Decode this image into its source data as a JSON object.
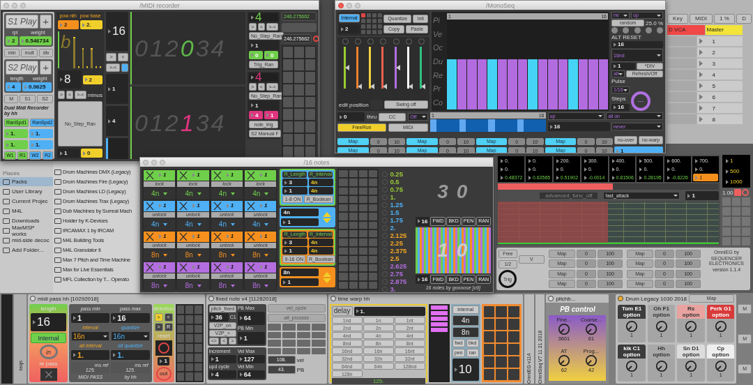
{
  "recorder": {
    "title": "/MIDI recorder",
    "s1": {
      "play": "S1 Play",
      "plus": "+",
      "labels": [
        "rpt",
        "weight"
      ],
      "values": [
        "2",
        "0.546734"
      ]
    },
    "ops": [
      "min",
      "mult",
      "div"
    ],
    "s2": {
      "play": "S2 Play",
      "plus": "+",
      "labels": [
        "length",
        "weight"
      ],
      "values": [
        "4",
        "0.0625"
      ]
    },
    "modes": [
      "M",
      "S1",
      "S2"
    ],
    "credit": "Dual Midi Recorder by hh",
    "ran": [
      "RanSpd1",
      "RanSpd2"
    ],
    "ran_values": [
      "1.",
      "1.",
      "1.",
      "1."
    ],
    "wr": [
      "W1",
      "R1",
      "W2",
      "R2"
    ],
    "pow_labels": [
      "pow nth",
      "pow base"
    ],
    "pow_values": [
      "2",
      "2."
    ],
    "bars_glyph": "b",
    "steps": "8",
    "steps_alt": "2",
    "dir_buttons": [
      ">",
      "<",
      ">-<"
    ],
    "minus": "minus",
    "mode": "No_Step_Ran",
    "bottom_values": [
      "1",
      "0"
    ],
    "length": "16",
    "len_buttons": [
      ">",
      "<",
      ">-<"
    ],
    "len_values": [
      "1",
      "4"
    ],
    "displays": [
      {
        "color": "#5fb84a",
        "digits": [
          {
            "text": "0",
            "current": false
          },
          {
            "text": "1",
            "current": false
          },
          {
            "text": "2",
            "current": false
          },
          {
            "text": "0",
            "current": true
          },
          {
            "text": "3",
            "current": false
          },
          {
            "text": "4",
            "current": false
          }
        ]
      },
      {
        "color": "#e0357f",
        "digits": [
          {
            "text": "0",
            "current": false
          },
          {
            "text": "1",
            "current": false
          },
          {
            "text": "2",
            "current": false
          },
          {
            "text": "1",
            "current": true
          },
          {
            "text": "3",
            "current": false
          },
          {
            "text": "4",
            "current": false
          }
        ]
      }
    ],
    "lanes": [
      {
        "value": "4",
        "buttons": [
          ">",
          "<",
          ">-<"
        ],
        "mode": "No_Step_Ran",
        "step": "1",
        "pair": [
          "0",
          "0"
        ],
        "trigger": "Trig_Ran",
        "color": "#6fcf4a"
      },
      {
        "value": "4",
        "buttons": [
          ">",
          "<",
          ">-<"
        ],
        "mode": "No_Step_Ran",
        "step": "1",
        "pair": [
          "4",
          "1"
        ],
        "trigger": "note_trig",
        "extra": "S2 Manual F",
        "color": "#e0357f"
      }
    ],
    "readouts": [
      "246.275662",
      "246.275662"
    ]
  },
  "monoseq": {
    "title": "/MonoSeq",
    "clock": "Internal",
    "channel": "2",
    "edit_buttons": [
      "Quantize",
      "Init",
      "Copy",
      "Paste"
    ],
    "sliders": [
      {
        "color": "#9acd32",
        "level": 0.5
      },
      {
        "color": "#f08030",
        "level": 0.05
      },
      {
        "color": "#f0d040",
        "level": 0.05
      },
      {
        "color": "#f06050",
        "level": 0.05
      },
      {
        "color": "#b070e0",
        "level": 0.5
      },
      {
        "color": "#ffffff",
        "level": 0.05
      },
      {
        "color": "#30c080",
        "level": 0.05
      }
    ],
    "edit_position": "edit position",
    "swing": "Swing off",
    "rows": [
      "Pi",
      "Ve",
      "Oc",
      "Du",
      "Re",
      "Pr",
      "Co"
    ],
    "range": {
      "start": "1",
      "end": "16",
      "level": 1
    },
    "steps": [
      {
        "accent": true
      },
      {
        "accent": false
      },
      {
        "accent": false
      },
      {
        "accent": false
      },
      {
        "accent": true
      },
      {
        "accent": false
      },
      {
        "accent": false
      },
      {
        "accent": false
      },
      {
        "accent": true
      },
      {
        "accent": false
      },
      {
        "accent": false
      },
      {
        "accent": false
      },
      {
        "accent": true
      },
      {
        "accent": false
      },
      {
        "accent": false
      },
      {
        "accent": false
      }
    ],
    "direction": [
      "ne",
      "up"
    ],
    "random": "random",
    "random_pct": "25.0 %",
    "alt_reset": "ALT RESET",
    "reset_value": "16",
    "division": "16nd",
    "div_value": "1",
    "div_op": "*DIV",
    "filter": "all",
    "refresh": "Refresh/Off",
    "pulse_label": "Pulse",
    "pulse": "1/16",
    "steps_label": "Steps",
    "steps_value": "16",
    "dial": "---",
    "footer": {
      "thru_value": "0",
      "thru": "thru",
      "cc": "CC",
      "midi_mode": "Off",
      "freerun": "FreeRun",
      "midi": "MIDI",
      "range": {
        "start": "1",
        "end": "16",
        "level": 1
      },
      "order": "up",
      "gate": "all on",
      "count": "16",
      "repeat": "never"
    },
    "maps": [
      {
        "label": "Map",
        "min": "0",
        "max": "10"
      },
      {
        "label": "Map",
        "min": "0",
        "max": "10"
      },
      {
        "label": "Map",
        "min": "0",
        "max": "10"
      },
      {
        "label": "Map",
        "min": "0",
        "max": "10"
      },
      {
        "label": "Map",
        "min": "0",
        "max": "10"
      },
      {
        "label": "Map",
        "min": "0",
        "max": "10"
      },
      {
        "label": "Map",
        "min": "0",
        "max": "10"
      },
      {
        "label": "Map",
        "min": "0",
        "max": "10"
      }
    ],
    "no_over": "no-over",
    "no_warp": "no-warp",
    "output": "1"
  },
  "live": {
    "toolbar": [
      "Key",
      "MIDI",
      "1 %",
      "D"
    ],
    "tracks": [
      {
        "name": "D VCA",
        "color": "#f04848"
      },
      {
        "name": "Master",
        "color": "#f2e43a"
      }
    ],
    "slots": [
      "1",
      "2",
      "3",
      "4",
      "5",
      "6",
      "7",
      "8"
    ]
  },
  "browser": {
    "places_title": "Places",
    "places": [
      {
        "label": "Packs",
        "selected": true
      },
      {
        "label": "User Library",
        "selected": false
      },
      {
        "label": "Current Projec",
        "selected": false
      },
      {
        "label": "M4L",
        "selected": false
      },
      {
        "label": "Downloads",
        "selected": false
      },
      {
        "label": "MaxMSP works",
        "selected": false
      },
      {
        "label": "mid-side decoc",
        "selected": false
      },
      {
        "label": "Add Folder...",
        "selected": false
      }
    ],
    "items": [
      "Drum Machines DMX (Legacy)",
      "Drum Machines Fire (Legacy)",
      "Drum Machines LD (Legacy)",
      "Drum Machines Trax (Legacy)",
      "Dub Machines by Surreal Mach",
      "Holder by K-Devices",
      "IRCAMAX 1 by IRCAM",
      "M4L Building Tools",
      "M4L Granulator II",
      "Max 7 Pitch and Time Machine",
      "Max for Live Essentials",
      "MFL Collection by T... Operato"
    ]
  },
  "notes": {
    "title": "/16 notes",
    "groups": [
      {
        "color": "#6fcf4a",
        "cells": [
          {
            "value": "1",
            "lock": "lock",
            "rate": "4n"
          },
          {
            "value": "1",
            "lock": "lock",
            "rate": "4n"
          },
          {
            "value": "1",
            "lock": "lock",
            "rate": "4n"
          },
          {
            "value": "1",
            "lock": "lock",
            "rate": "4n"
          }
        ]
      },
      {
        "color": "#4fb0f5",
        "cells": [
          {
            "value": "1",
            "lock": "unlock",
            "rate": "4n"
          },
          {
            "value": "1",
            "lock": "unlock",
            "rate": "4n"
          },
          {
            "value": "1",
            "lock": "unlock",
            "rate": "4n"
          },
          {
            "value": "1",
            "lock": "unlock",
            "rate": "4n"
          }
        ]
      },
      {
        "color": "#f5901e",
        "cells": [
          {
            "value": "1",
            "lock": "unlock",
            "rate": "8n"
          },
          {
            "value": "1",
            "lock": "unlock",
            "rate": "8n"
          },
          {
            "value": "1",
            "lock": "unlock",
            "rate": "8n"
          },
          {
            "value": "1",
            "lock": "unlock",
            "rate": "8n"
          }
        ]
      },
      {
        "color": "#b46ee0",
        "cells": [
          {
            "value": "1",
            "lock": "unlock",
            "rate": "8n"
          },
          {
            "value": "1",
            "lock": "unlock",
            "rate": "8n"
          },
          {
            "value": "1",
            "lock": "unlock",
            "rate": "8n"
          },
          {
            "value": "1",
            "lock": "unlock",
            "rate": "8n"
          }
        ]
      }
    ],
    "randomizers": [
      {
        "color": "#4fb0f5",
        "labels": [
          "R_Length",
          "R_Interval"
        ],
        "rows": [
          [
            "3",
            "4n"
          ],
          [
            "1",
            "4n"
          ]
        ],
        "toggle": "1-8 ON",
        "boolean": "R_Boolean",
        "rate": "4n",
        "value": "1"
      },
      {
        "color": "#f5901e",
        "labels": [
          "R_Length",
          "R_Interval"
        ],
        "rows": [
          [
            "3",
            "4n"
          ],
          [
            "1",
            "4n"
          ]
        ],
        "toggle": "9-16 ON",
        "boolean": "R_Boolean",
        "rate": "8n",
        "value": "1"
      }
    ],
    "values": [
      {
        "text": "0.25",
        "color": "#9acd32"
      },
      {
        "text": "0.5",
        "color": "#9acd32"
      },
      {
        "text": "0.75",
        "color": "#9acd32"
      },
      {
        "text": "1.",
        "color": "#9acd32"
      },
      {
        "text": "1.25",
        "color": "#4fb0f5"
      },
      {
        "text": "1.5",
        "color": "#4fb0f5"
      },
      {
        "text": "1.75",
        "color": "#4fb0f5"
      },
      {
        "text": "2.",
        "color": "#4fb0f5"
      },
      {
        "text": "2.125",
        "color": "#f5a623"
      },
      {
        "text": "2.25",
        "color": "#f5a623"
      },
      {
        "text": "2.375",
        "color": "#f5a623"
      },
      {
        "text": "2.5",
        "color": "#f5a623"
      },
      {
        "text": "2.625",
        "color": "#b46ee0"
      },
      {
        "text": "2.75",
        "color": "#b46ee0"
      },
      {
        "text": "2.875",
        "color": "#b46ee0"
      },
      {
        "text": "3.",
        "color": "#b46ee0"
      }
    ],
    "displays": [
      {
        "number": "3 0",
        "steps": "16",
        "buttons": [
          "FWD",
          "BKD",
          "PEN",
          "RAN"
        ]
      },
      {
        "number": "1 0",
        "steps": "16",
        "buttons": [
          "FWD",
          "BKD",
          "PEN",
          "RAN"
        ]
      }
    ],
    "credit": "16 notes by goooose [v9]"
  },
  "omnieg": {
    "columns": [
      {
        "time": "0.",
        "level": "0.",
        "value": "0.48372",
        "active": false
      },
      {
        "time": "0.",
        "level": "0.",
        "value": "0.63565",
        "active": false
      },
      {
        "time": "200.",
        "level": "0.",
        "value": "0.51902",
        "active": false
      },
      {
        "time": "300.",
        "level": "0.",
        "value": "-0.0014",
        "active": false
      },
      {
        "time": "400.",
        "level": "0.",
        "value": "0.81506",
        "active": false
      },
      {
        "time": "500.",
        "level": "0.",
        "value": "0.28195",
        "active": false
      },
      {
        "time": "600.",
        "level": "0.",
        "value": "-0.6226",
        "active": false
      },
      {
        "time": "700.",
        "level": "0.",
        "value": "1",
        "active": true
      }
    ],
    "side": [
      "1",
      "500",
      "1000"
    ],
    "scale": "1.00",
    "progress": {
      "level": 0.52
    },
    "func": "advanced_func_off",
    "curve": "fast_attack",
    "curve_value": "1",
    "clock": [
      "Free",
      "1/2"
    ],
    "v": "V",
    "trig": "Trig",
    "maps": [
      {
        "label": "Map",
        "min": "0",
        "max": "100"
      },
      {
        "label": "Map",
        "min": "0",
        "max": "100"
      },
      {
        "label": "Map",
        "min": "0",
        "max": "100"
      },
      {
        "label": "Map",
        "min": "0",
        "max": "100"
      },
      {
        "label": "Map",
        "min": "0",
        "max": "100"
      },
      {
        "label": "Map",
        "min": "0",
        "max": "100"
      },
      {
        "label": "Map",
        "min": "0",
        "max": "100"
      },
      {
        "label": "Map",
        "min": "0",
        "max": "100"
      }
    ],
    "credit": [
      "OmniEG by",
      "SEQUENCER ELECTRONICS",
      "version 1.1.4"
    ]
  },
  "devices": {
    "strip_label": "seqs",
    "midipass": {
      "title": "midi pass hh [10292018]",
      "length_label": "length",
      "length": "16",
      "clock": "Internal",
      "in": "in",
      "repass": "re pass",
      "pass_labels": [
        "pass min",
        "pass max"
      ],
      "pass": [
        "1",
        "16"
      ],
      "interval_labels": [
        "interval",
        "quantize"
      ],
      "intervals": [
        "16n",
        "16n"
      ],
      "alt_labels": [
        "alt interval",
        "alt quantize"
      ],
      "alts": [
        "1.",
        "1."
      ],
      "ms": [
        {
          "value": "125.",
          "label": "ms ref"
        },
        {
          "value": "125.",
          "label": "ms ref"
        }
      ],
      "footer": [
        "MIDI PASS",
        "by hh"
      ],
      "direction": "direction",
      "dir_buttons": [
        ">",
        "<",
        ">",
        "R"
      ],
      "reset": "reset",
      "count": "1",
      "out": "out"
    },
    "fixednote": {
      "title": "fixed note v4 [11282018]",
      "pitch_label": "pitch_fixed",
      "pitch": "36",
      "note": "C1",
      "v2p": [
        "V2P_on",
        "V2P_>"
      ],
      "arrows": [
        "<>",
        "<",
        ">"
      ],
      "pb": [
        {
          "label": "PB Max",
          "value": "64"
        },
        {
          "label": "PB Min",
          "value": "1"
        }
      ],
      "inc": [
        {
          "label": "increment",
          "value": "1"
        },
        {
          "label": "upd cycle",
          "value": "4"
        }
      ],
      "vel": [
        {
          "label": "Vel Max",
          "value": "127"
        },
        {
          "label": "Vel Min",
          "value": "64"
        }
      ],
      "cycle": [
        "vel_cycle",
        "alt_process"
      ],
      "outs": [
        {
          "value": "108.",
          "label": "vel"
        },
        {
          "value": "43.",
          "label": "PB"
        }
      ]
    },
    "timewarp": {
      "title": "time warp hh",
      "delay": "delay",
      "delay_value": "1.",
      "rates": [
        [
          "1nd",
          "1n",
          "1nt"
        ],
        [
          "2nd",
          "2n",
          "2nt"
        ],
        [
          "4nd",
          "4n",
          "4nt"
        ],
        [
          "8nd",
          "8n",
          "8nt"
        ],
        [
          "16nd",
          "16n",
          "16nt"
        ],
        [
          "32nd",
          "32n",
          "32nt"
        ],
        [
          "64nd",
          "64n",
          "128nd"
        ],
        [
          "128n"
        ]
      ],
      "ms": "125.",
      "clock": "internal",
      "rates2": [
        "4n",
        "8n"
      ],
      "modes": [
        "fwd",
        "bkd",
        "pen",
        "ran"
      ],
      "count": "10"
    },
    "vertical": [
      "OmniEG v114",
      "OmniSeq V7 11 21 2018"
    ],
    "pitchbend": {
      "title": "pitchb...",
      "heading": "PB control",
      "knobs": [
        {
          "label": "Fine...",
          "value": "3601"
        },
        {
          "label": "Coarse...",
          "value": "61"
        },
        {
          "label": "AT",
          "value": "62"
        },
        {
          "label": "Prog...",
          "value": "42"
        }
      ]
    },
    "drum": {
      "title": "Drum Legacy 1030 2018",
      "map": "Map",
      "pads": [
        {
          "name": "Tom E1",
          "option": "option",
          "value": "1",
          "kind": "dark"
        },
        {
          "name": "Oh F1",
          "option": "option",
          "value": "1",
          "kind": "grey"
        },
        {
          "name": "Rs",
          "option": "option",
          "value": "1",
          "kind": "pink"
        },
        {
          "name": "Perk G1",
          "option": "option",
          "value": "1",
          "kind": "red"
        },
        {
          "name": "kik C1",
          "option": "option",
          "value": "1",
          "kind": "dark"
        },
        {
          "name": "Hh",
          "option": "option",
          "value": "1",
          "kind": "grey"
        },
        {
          "name": "Sn D1",
          "option": "option",
          "value": "1",
          "kind": "light"
        },
        {
          "name": "Cp",
          "option": "option",
          "value": "1",
          "kind": "white"
        }
      ]
    },
    "mixer": [
      "M",
      "M",
      "M"
    ]
  }
}
